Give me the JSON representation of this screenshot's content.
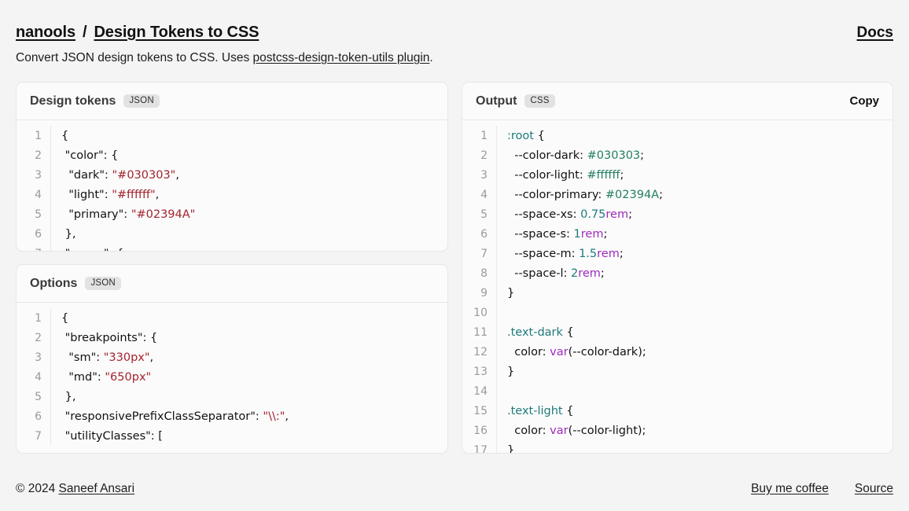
{
  "header": {
    "brand": "nanools",
    "separator": "/",
    "page_title": "Design Tokens to CSS",
    "docs_label": "Docs",
    "subtitle_before": "Convert JSON design tokens to CSS. Uses ",
    "subtitle_link": "postcss-design-token-utils plugin",
    "subtitle_after": "."
  },
  "panels": {
    "tokens": {
      "title": "Design tokens",
      "badge": "JSON",
      "lines": [
        {
          "n": "1",
          "segments": [
            {
              "t": "punct",
              "s": "{"
            }
          ]
        },
        {
          "n": "2",
          "segments": [
            {
              "t": "key",
              "s": " \"color\": {"
            }
          ]
        },
        {
          "n": "3",
          "segments": [
            {
              "t": "key",
              "s": "  \"dark\": "
            },
            {
              "t": "str",
              "s": "\"#030303\""
            },
            {
              "t": "punct",
              "s": ","
            }
          ]
        },
        {
          "n": "4",
          "segments": [
            {
              "t": "key",
              "s": "  \"light\": "
            },
            {
              "t": "str",
              "s": "\"#ffffff\""
            },
            {
              "t": "punct",
              "s": ","
            }
          ]
        },
        {
          "n": "5",
          "segments": [
            {
              "t": "key",
              "s": "  \"primary\": "
            },
            {
              "t": "str",
              "s": "\"#02394A\""
            }
          ]
        },
        {
          "n": "6",
          "segments": [
            {
              "t": "punct",
              "s": " },"
            }
          ]
        },
        {
          "n": "7",
          "segments": [
            {
              "t": "key",
              "s": " \"space\": {"
            }
          ]
        }
      ]
    },
    "options": {
      "title": "Options",
      "badge": "JSON",
      "lines": [
        {
          "n": "1",
          "segments": [
            {
              "t": "punct",
              "s": "{"
            }
          ]
        },
        {
          "n": "2",
          "segments": [
            {
              "t": "key",
              "s": " \"breakpoints\": {"
            }
          ]
        },
        {
          "n": "3",
          "segments": [
            {
              "t": "key",
              "s": "  \"sm\": "
            },
            {
              "t": "str",
              "s": "\"330px\""
            },
            {
              "t": "punct",
              "s": ","
            }
          ]
        },
        {
          "n": "4",
          "segments": [
            {
              "t": "key",
              "s": "  \"md\": "
            },
            {
              "t": "str",
              "s": "\"650px\""
            }
          ]
        },
        {
          "n": "5",
          "segments": [
            {
              "t": "punct",
              "s": " },"
            }
          ]
        },
        {
          "n": "6",
          "segments": [
            {
              "t": "key",
              "s": " \"responsivePrefixClassSeparator\": "
            },
            {
              "t": "str",
              "s": "\"\\\\:\""
            },
            {
              "t": "punct",
              "s": ","
            }
          ]
        },
        {
          "n": "7",
          "segments": [
            {
              "t": "key",
              "s": " \"utilityClasses\": ["
            }
          ]
        }
      ]
    },
    "output": {
      "title": "Output",
      "badge": "CSS",
      "copy_label": "Copy",
      "lines": [
        {
          "n": "1",
          "segments": [
            {
              "t": "sel",
              "s": ":root"
            },
            {
              "t": "punct",
              "s": " {"
            }
          ]
        },
        {
          "n": "2",
          "segments": [
            {
              "t": "prop",
              "s": "  --color-dark: "
            },
            {
              "t": "hex",
              "s": "#030303"
            },
            {
              "t": "punct",
              "s": ";"
            }
          ]
        },
        {
          "n": "3",
          "segments": [
            {
              "t": "prop",
              "s": "  --color-light: "
            },
            {
              "t": "hex",
              "s": "#ffffff"
            },
            {
              "t": "punct",
              "s": ";"
            }
          ]
        },
        {
          "n": "4",
          "segments": [
            {
              "t": "prop",
              "s": "  --color-primary: "
            },
            {
              "t": "hex",
              "s": "#02394A"
            },
            {
              "t": "punct",
              "s": ";"
            }
          ]
        },
        {
          "n": "5",
          "segments": [
            {
              "t": "prop",
              "s": "  --space-xs: "
            },
            {
              "t": "num",
              "s": "0.75"
            },
            {
              "t": "unit",
              "s": "rem"
            },
            {
              "t": "punct",
              "s": ";"
            }
          ]
        },
        {
          "n": "6",
          "segments": [
            {
              "t": "prop",
              "s": "  --space-s: "
            },
            {
              "t": "num",
              "s": "1"
            },
            {
              "t": "unit",
              "s": "rem"
            },
            {
              "t": "punct",
              "s": ";"
            }
          ]
        },
        {
          "n": "7",
          "segments": [
            {
              "t": "prop",
              "s": "  --space-m: "
            },
            {
              "t": "num",
              "s": "1.5"
            },
            {
              "t": "unit",
              "s": "rem"
            },
            {
              "t": "punct",
              "s": ";"
            }
          ]
        },
        {
          "n": "8",
          "segments": [
            {
              "t": "prop",
              "s": "  --space-l: "
            },
            {
              "t": "num",
              "s": "2"
            },
            {
              "t": "unit",
              "s": "rem"
            },
            {
              "t": "punct",
              "s": ";"
            }
          ]
        },
        {
          "n": "9",
          "segments": [
            {
              "t": "punct",
              "s": "}"
            }
          ]
        },
        {
          "n": "10",
          "segments": [
            {
              "t": "punct",
              "s": ""
            }
          ]
        },
        {
          "n": "11",
          "segments": [
            {
              "t": "sel",
              "s": ".text-dark"
            },
            {
              "t": "punct",
              "s": " {"
            }
          ]
        },
        {
          "n": "12",
          "segments": [
            {
              "t": "prop",
              "s": "  color: "
            },
            {
              "t": "fn",
              "s": "var"
            },
            {
              "t": "punct",
              "s": "(--color-dark);"
            }
          ]
        },
        {
          "n": "13",
          "segments": [
            {
              "t": "punct",
              "s": "}"
            }
          ]
        },
        {
          "n": "14",
          "segments": [
            {
              "t": "punct",
              "s": ""
            }
          ]
        },
        {
          "n": "15",
          "segments": [
            {
              "t": "sel",
              "s": ".text-light"
            },
            {
              "t": "punct",
              "s": " {"
            }
          ]
        },
        {
          "n": "16",
          "segments": [
            {
              "t": "prop",
              "s": "  color: "
            },
            {
              "t": "fn",
              "s": "var"
            },
            {
              "t": "punct",
              "s": "(--color-light);"
            }
          ]
        },
        {
          "n": "17",
          "segments": [
            {
              "t": "punct",
              "s": "}"
            }
          ]
        }
      ]
    }
  },
  "footer": {
    "copyright_prefix": "© 2024 ",
    "author": "Saneef Ansari",
    "buy_coffee": "Buy me coffee",
    "source": "Source"
  }
}
